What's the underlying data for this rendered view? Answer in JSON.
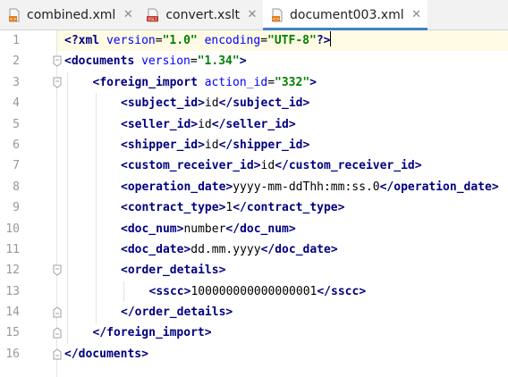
{
  "tabs": [
    {
      "label": "combined.xml",
      "icon": "xml-file-icon",
      "active": false
    },
    {
      "label": "convert.xslt",
      "icon": "xslt-file-icon",
      "active": false
    },
    {
      "label": "document003.xml",
      "icon": "xml-file-icon",
      "active": true
    }
  ],
  "close_glyph": "✕",
  "colors": {
    "tag": "#000080",
    "attribute": "#0000ff",
    "value": "#008000",
    "active_tab_underline": "#4083c9",
    "current_line": "#fffae3"
  },
  "editor": {
    "current_line": 1,
    "lines": [
      {
        "n": "1",
        "indent": 0,
        "tokens": [
          [
            "tag",
            "<?xml "
          ],
          [
            "attr",
            "version"
          ],
          [
            "txt",
            "="
          ],
          [
            "val",
            "\"1.0\""
          ],
          [
            "txt",
            " "
          ],
          [
            "attr",
            "encoding"
          ],
          [
            "txt",
            "="
          ],
          [
            "val",
            "\"UTF-8\""
          ],
          [
            "tag",
            "?>"
          ]
        ]
      },
      {
        "n": "2",
        "indent": 0,
        "tokens": [
          [
            "tag",
            "<documents "
          ],
          [
            "attr",
            "version"
          ],
          [
            "txt",
            "="
          ],
          [
            "val",
            "\"1.34\""
          ],
          [
            "tag",
            ">"
          ]
        ]
      },
      {
        "n": "3",
        "indent": 1,
        "tokens": [
          [
            "tag",
            "<foreign_import "
          ],
          [
            "attr",
            "action_id"
          ],
          [
            "txt",
            "="
          ],
          [
            "val",
            "\"332\""
          ],
          [
            "tag",
            ">"
          ]
        ]
      },
      {
        "n": "4",
        "indent": 2,
        "tokens": [
          [
            "tag",
            "<subject_id>"
          ],
          [
            "txt",
            "id"
          ],
          [
            "tag",
            "</subject_id>"
          ]
        ]
      },
      {
        "n": "5",
        "indent": 2,
        "tokens": [
          [
            "tag",
            "<seller_id>"
          ],
          [
            "txt",
            "id"
          ],
          [
            "tag",
            "</seller_id>"
          ]
        ]
      },
      {
        "n": "6",
        "indent": 2,
        "tokens": [
          [
            "tag",
            "<shipper_id>"
          ],
          [
            "txt",
            "id"
          ],
          [
            "tag",
            "</shipper_id>"
          ]
        ]
      },
      {
        "n": "7",
        "indent": 2,
        "tokens": [
          [
            "tag",
            "<custom_receiver_id>"
          ],
          [
            "txt",
            "id"
          ],
          [
            "tag",
            "</custom_receiver_id>"
          ]
        ]
      },
      {
        "n": "8",
        "indent": 2,
        "tokens": [
          [
            "tag",
            "<operation_date>"
          ],
          [
            "txt",
            "yyyy-mm-ddThh:mm:ss.0"
          ],
          [
            "tag",
            "</operation_date>"
          ]
        ]
      },
      {
        "n": "9",
        "indent": 2,
        "tokens": [
          [
            "tag",
            "<contract_type>"
          ],
          [
            "txt",
            "1"
          ],
          [
            "tag",
            "</contract_type>"
          ]
        ]
      },
      {
        "n": "10",
        "indent": 2,
        "tokens": [
          [
            "tag",
            "<doc_num>"
          ],
          [
            "txt",
            "number"
          ],
          [
            "tag",
            "</doc_num>"
          ]
        ]
      },
      {
        "n": "11",
        "indent": 2,
        "tokens": [
          [
            "tag",
            "<doc_date>"
          ],
          [
            "txt",
            "dd.mm.yyyy"
          ],
          [
            "tag",
            "</doc_date>"
          ]
        ]
      },
      {
        "n": "12",
        "indent": 2,
        "tokens": [
          [
            "tag",
            "<order_details>"
          ]
        ]
      },
      {
        "n": "13",
        "indent": 3,
        "tokens": [
          [
            "tag",
            "<sscc>"
          ],
          [
            "txt",
            "100000000000000001"
          ],
          [
            "tag",
            "</sscc>"
          ]
        ]
      },
      {
        "n": "14",
        "indent": 2,
        "tokens": [
          [
            "tag",
            "</order_details>"
          ]
        ]
      },
      {
        "n": "15",
        "indent": 1,
        "tokens": [
          [
            "tag",
            "</foreign_import>"
          ]
        ]
      },
      {
        "n": "16",
        "indent": 0,
        "tokens": [
          [
            "tag",
            "</documents>"
          ]
        ]
      }
    ]
  }
}
